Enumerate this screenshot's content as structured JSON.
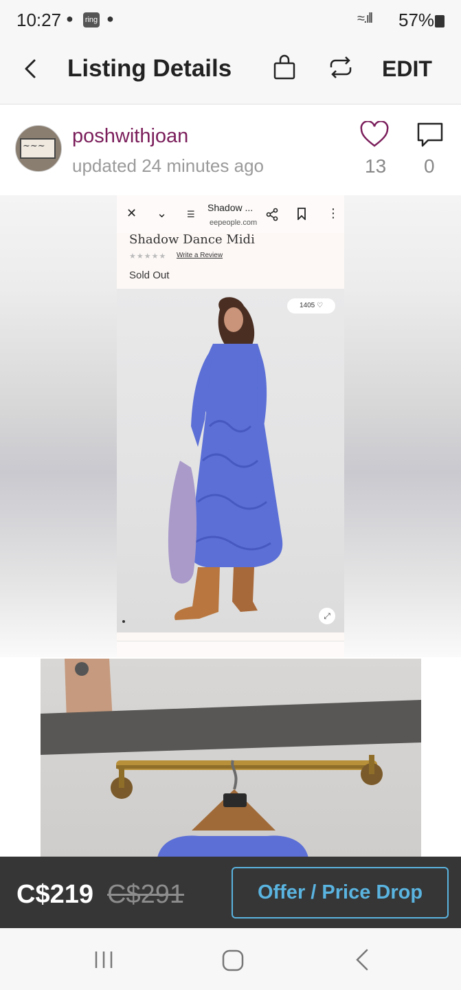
{
  "status_bar": {
    "time": "10:27",
    "ring_label": "ring",
    "battery": "57%"
  },
  "app_bar": {
    "title": "Listing Details",
    "edit_label": "EDIT"
  },
  "seller": {
    "username": "poshwithjoan",
    "updated": "updated 24 minutes ago",
    "likes": "13",
    "comments": "0"
  },
  "screenshot_in_photo": {
    "tab_title": "Shadow ...",
    "url": "eepeople.com",
    "product_name": "Shadow Dance Midi",
    "review_link": "Write a Review",
    "stock_status": "Sold Out",
    "likes_pill": "1405"
  },
  "price": {
    "current": "C$219",
    "original": "C$291",
    "offer_button": "Offer / Price Drop"
  },
  "colors": {
    "username": "#7a1d5a",
    "offer_accent": "#5ab4e0",
    "bottom_bar": "#363636",
    "dress": "#5b6fd6"
  },
  "icons": [
    "back-arrow-icon",
    "shopping-bag-icon",
    "share-icon",
    "heart-icon",
    "comment-icon",
    "recents-nav-icon",
    "home-nav-icon",
    "back-nav-icon"
  ]
}
